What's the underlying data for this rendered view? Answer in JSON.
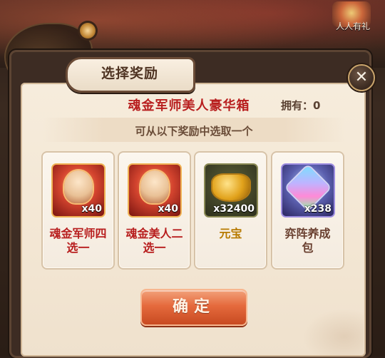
{
  "background": {
    "gift_label": "人人有礼"
  },
  "dialog": {
    "title": "选择奖励",
    "close_symbol": "✕",
    "box_name": "魂金军师美人豪华箱",
    "owned_label": "拥有：0",
    "hint": "可从以下奖励中选取一个",
    "confirm_label": "确定"
  },
  "rewards": [
    {
      "name": "魂金军师四选一",
      "quantity": "x40",
      "icon": "hero-portrait-icon",
      "color": "#b81e1e"
    },
    {
      "name": "魂金美人二选一",
      "quantity": "x40",
      "icon": "heroine-portrait-icon",
      "color": "#b81e1e"
    },
    {
      "name": "元宝",
      "quantity": "x32400",
      "icon": "gold-ingot-icon",
      "color": "#b77a00"
    },
    {
      "name": "弈阵养成包",
      "quantity": "x238",
      "icon": "gem-pack-icon",
      "color": "#6a4030"
    }
  ],
  "colors": {
    "accent_red": "#b81e1e",
    "confirm_orange": "#e56a3d",
    "panel_bg": "#f3e6d3"
  }
}
